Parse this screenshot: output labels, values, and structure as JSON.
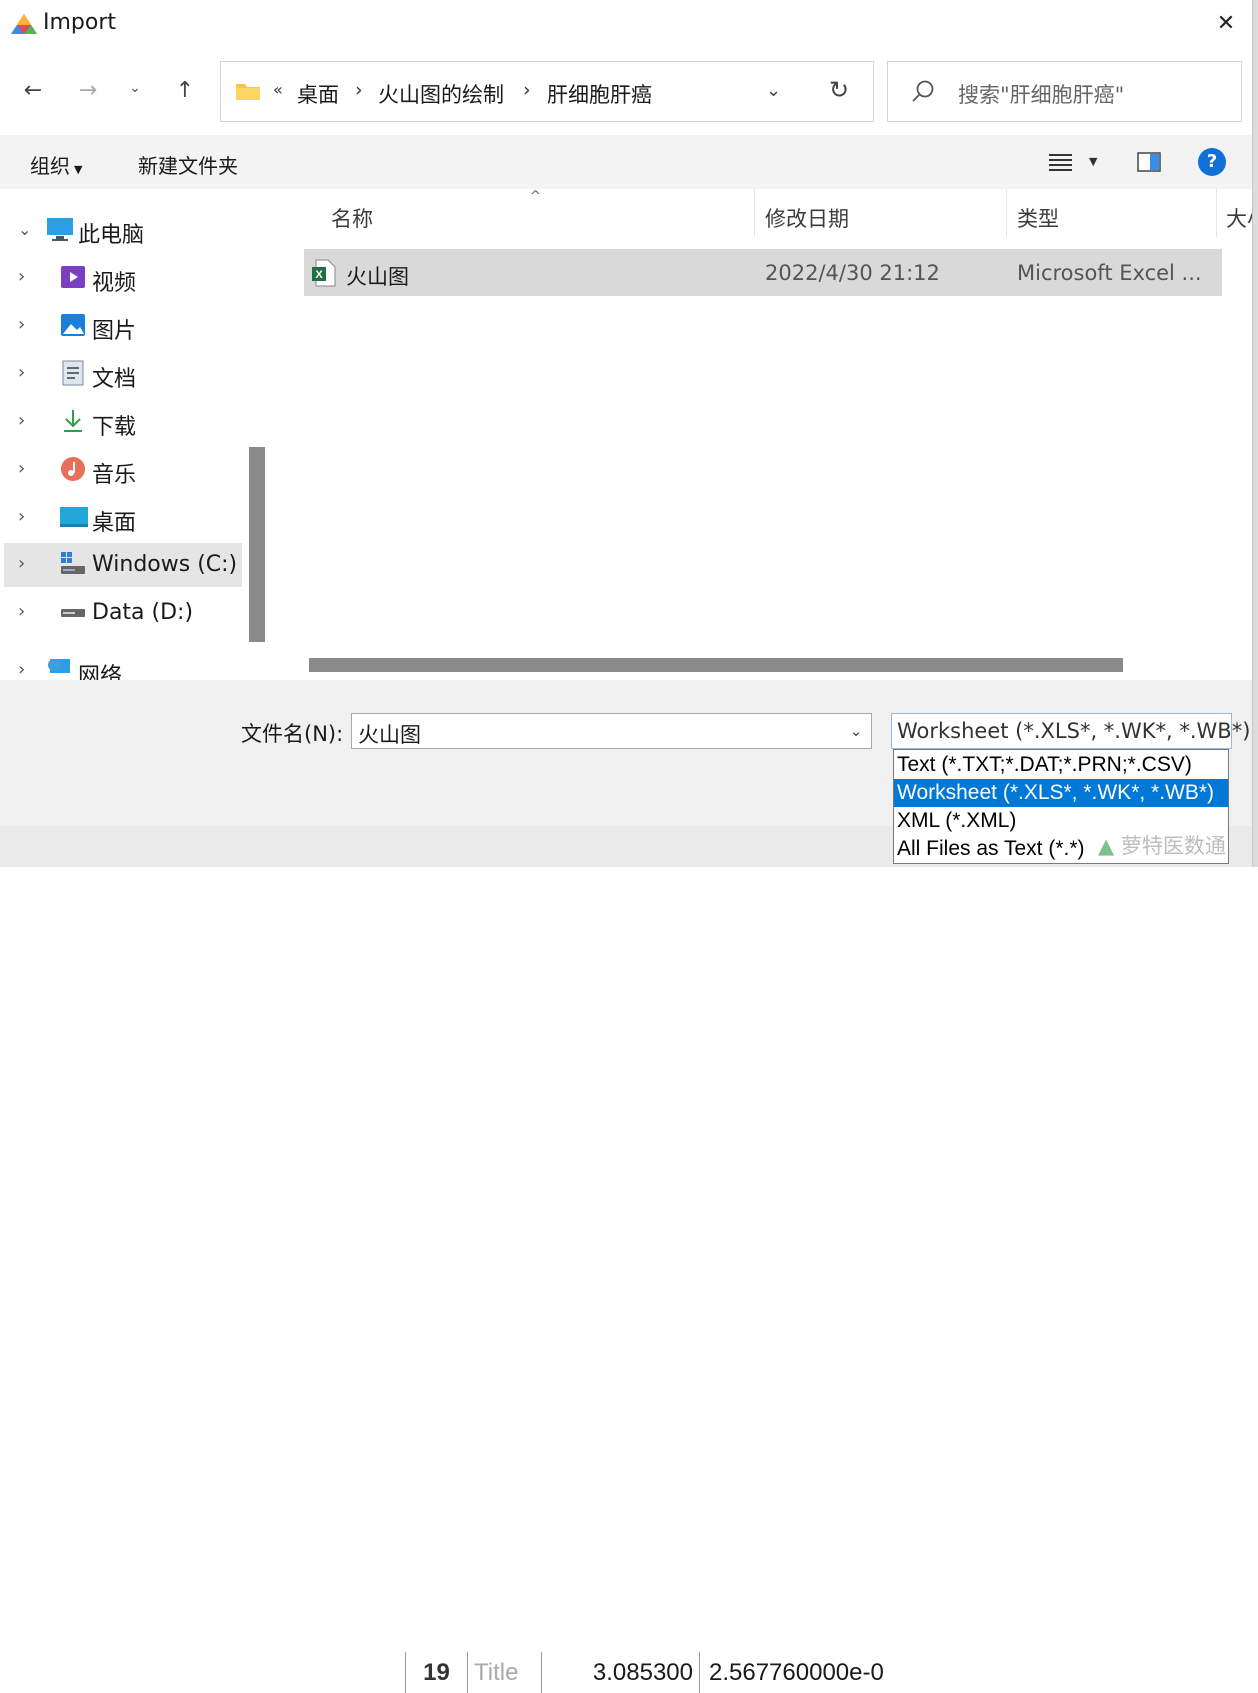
{
  "window": {
    "title": "Import"
  },
  "address": {
    "overflow": "«",
    "crumbs": [
      "桌面",
      "火山图的绘制",
      "肝细胞肝癌"
    ]
  },
  "search": {
    "placeholder": "搜索\"肝细胞肝癌\""
  },
  "toolbar": {
    "organize": "组织",
    "new_folder": "新建文件夹",
    "help": "?"
  },
  "nav": {
    "items": [
      {
        "label": "此电脑",
        "icon": "computer-icon"
      },
      {
        "label": "视频",
        "icon": "video-icon"
      },
      {
        "label": "图片",
        "icon": "picture-icon"
      },
      {
        "label": "文档",
        "icon": "document-icon"
      },
      {
        "label": "下载",
        "icon": "download-icon"
      },
      {
        "label": "音乐",
        "icon": "music-icon"
      },
      {
        "label": "桌面",
        "icon": "desktop-icon"
      },
      {
        "label": "Windows (C:)",
        "icon": "drive-c-icon"
      },
      {
        "label": "Data (D:)",
        "icon": "drive-d-icon"
      },
      {
        "label": "网络",
        "icon": "network-icon"
      }
    ]
  },
  "columns": {
    "name": "名称",
    "modified": "修改日期",
    "type": "类型",
    "size": "大小"
  },
  "files": [
    {
      "name": "火山图",
      "modified": "2022/4/30 21:12",
      "type": "Microsoft Excel ...",
      "icon": "excel-file-icon"
    }
  ],
  "filename": {
    "label": "文件名(N):",
    "value": "火山图"
  },
  "filetype": {
    "selected": "Worksheet (*.XLS*, *.WK*, *.WB*)",
    "options": [
      "Text (*.TXT;*.DAT;*.PRN;*.CSV)",
      "Worksheet (*.XLS*, *.WK*, *.WB*)",
      "XML (*.XML)",
      "All Files as Text (*.*)"
    ]
  },
  "background_sheet": {
    "row": "19",
    "col1": "Title",
    "col2": "3.085300",
    "col3": "2.567760000e-0"
  },
  "watermark": "萝特医数通",
  "colors": {
    "accent": "#0078d7",
    "selection": "#d9d9d9",
    "scrollbar": "#8a8a8a"
  }
}
